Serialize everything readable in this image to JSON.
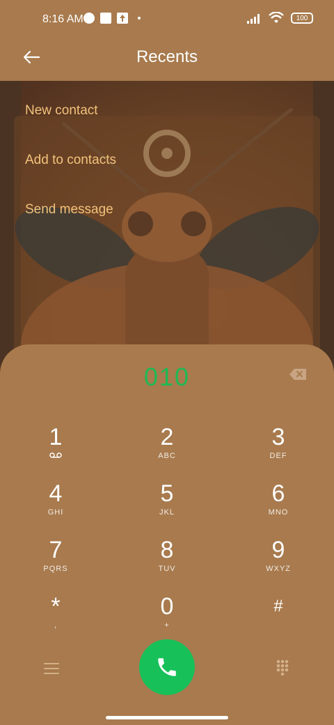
{
  "status_bar": {
    "time": "8:16 AM",
    "battery": "100"
  },
  "header": {
    "title": "Recents"
  },
  "menu": [
    {
      "label": "New contact"
    },
    {
      "label": "Add to contacts"
    },
    {
      "label": "Send message"
    }
  ],
  "dialer": {
    "number": "010",
    "keys": [
      {
        "num": "1",
        "sub": "voicemail-icon"
      },
      {
        "num": "2",
        "sub": "ABC"
      },
      {
        "num": "3",
        "sub": "DEF"
      },
      {
        "num": "4",
        "sub": "GHI"
      },
      {
        "num": "5",
        "sub": "JKL"
      },
      {
        "num": "6",
        "sub": "MNO"
      },
      {
        "num": "7",
        "sub": "PQRS"
      },
      {
        "num": "8",
        "sub": "TUV"
      },
      {
        "num": "9",
        "sub": "WXYZ"
      },
      {
        "num": "*",
        "sub": ","
      },
      {
        "num": "0",
        "sub": "+"
      },
      {
        "num": "#",
        "sub": ""
      }
    ]
  },
  "colors": {
    "background": "#a87a4d",
    "accent_green": "#18c05a",
    "digits_green": "#1db954",
    "menu_text": "#f3c27b"
  }
}
